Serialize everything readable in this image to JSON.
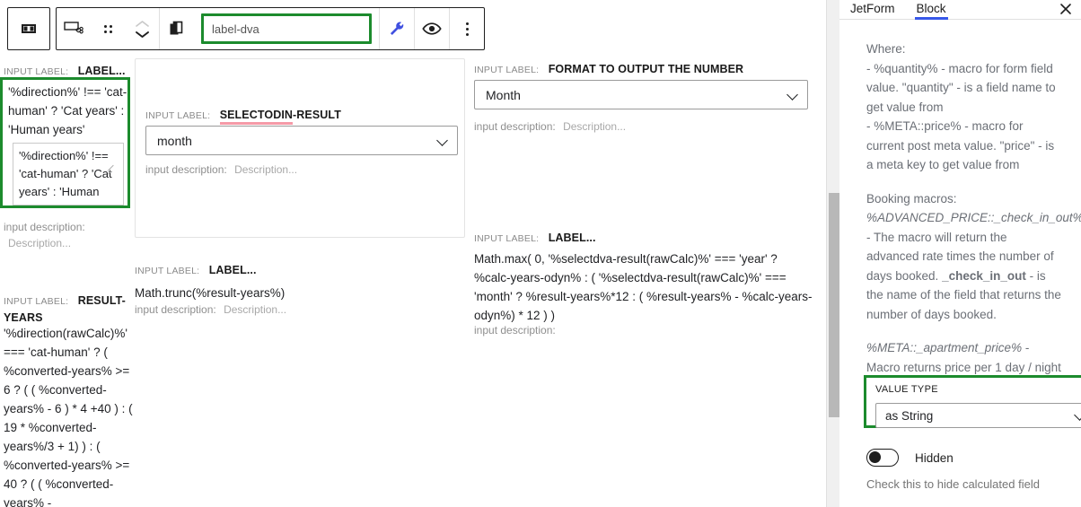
{
  "toolbar": {
    "sidebar_toggle_icon": "columns-icon",
    "block_type_icon": "calculated-field-block-icon",
    "drag_handle_icon": "drag-handle-icon",
    "move_up_icon": "chevron-up-icon",
    "move_down_icon": "chevron-down-icon",
    "duplicate_icon": "copy-icon",
    "name_field_value": "label-dva",
    "name_field_placeholder": "label-dva",
    "tools_icon": "wrench-icon",
    "preview_icon": "eye-icon",
    "more_icon": "more-vertical-icon"
  },
  "left_column": {
    "label_key": "INPUT LABEL:",
    "label_value": "LABEL...",
    "formula": "'%direction%' !== 'cat-human' ? 'Cat years' : 'Human years'",
    "textarea_value": "'%direction%' !== 'cat-human' ? 'Cat years' : 'Human years'",
    "desc_key": "input description:",
    "desc_value": "Description...",
    "label_key2": "INPUT LABEL:",
    "label_value2": "RESULT-YEARS",
    "formula2": "'%direction(rawCalc)%' === 'cat-human' ? ( %converted-years% >= 6 ? ( ( %converted-years% - 6 ) * 4 +40 ) : ( 19 * %converted-years%/3 + 1) ) : ( %converted-years% >= 40 ? ( ( %converted-years% -"
  },
  "middle_card": {
    "label_key": "INPUT LABEL:",
    "label_value_underlined": "SELECTODIN",
    "label_value_rest": "-RESULT",
    "select_value": "month",
    "chevron_icon": "chevron-down-icon",
    "desc_key": "input description:",
    "desc_value": "Description..."
  },
  "middle_lower": {
    "label_key": "INPUT LABEL:",
    "label_value": "LABEL...",
    "formula": "Math.trunc(%result-years%)",
    "desc_key": "input description:",
    "desc_value": "Description..."
  },
  "third_column": {
    "label_key": "INPUT LABEL:",
    "label_value": "FORMAT TO OUTPUT THE NUMBER",
    "select_value": "Month",
    "chevron_icon": "chevron-down-icon",
    "desc_key": "input description:",
    "desc_value": "Description...",
    "label_key2": "INPUT LABEL:",
    "label_value2": "LABEL...",
    "formula": "Math.max( 0, '%selectdva-result(rawCalc)%' === 'year' ? %calc-years-odyn% : ( '%selectdva-result(rawCalc)%' === 'month' ? %result-years%*12 : ( %result-years% - %calc-years-odyn%) * 12 ) )",
    "desc_key2": "input description:"
  },
  "sidebar": {
    "tab_jetform": "JetForm",
    "tab_block": "Block",
    "close_icon": "close-icon",
    "help_p1_line1": "Where:",
    "help_p1_line2": "- %quantity% - macro for form field value. \"quantity\" - is a field name to get value from",
    "help_p1_line3": "- %META::price% - macro for current post meta value. \"price\" - is a meta key to get value from",
    "help_p2_heading": "Booking macros:",
    "help_p2_macro": "%ADVANCED_PRICE::_check_in_out%",
    "help_p2_text_a": " - The macro will return the advanced rate times the number of days booked. ",
    "help_p2_bold": "_check_in_out",
    "help_p2_text_b": " - is the name of the field that returns the number of days booked.",
    "help_p3_macro": "%META::_apartment_price%",
    "help_p3_text": " - Macro returns price per 1 day / night",
    "value_type_label": "VALUE TYPE",
    "value_type_value": "as String",
    "value_type_chevron_icon": "chevron-down-icon",
    "hidden_toggle_label": "Hidden",
    "hidden_hint": "Check this to hide calculated field"
  },
  "colors": {
    "highlight_green": "#1c8b2d",
    "accent_blue": "#3858e9",
    "wrench_blue": "#4050e0",
    "squiggle_pink": "#f59aa7"
  }
}
